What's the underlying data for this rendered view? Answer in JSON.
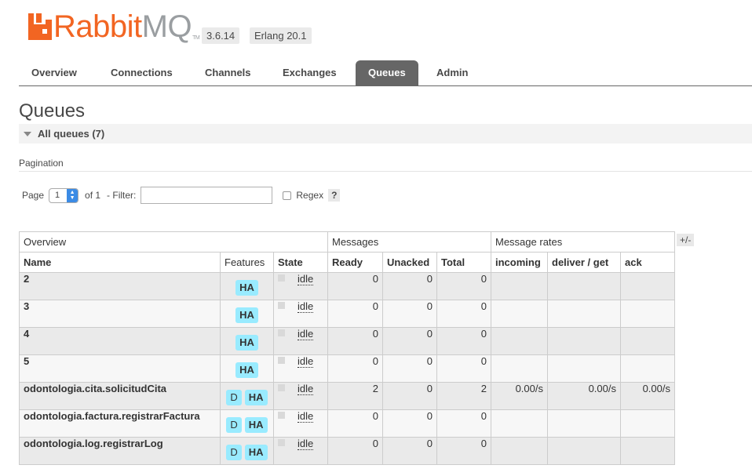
{
  "header": {
    "logo_rabbit": "Rabbit",
    "logo_mq": "MQ",
    "logo_tm": "TM",
    "version": "3.6.14",
    "erlang": "Erlang 20.1"
  },
  "tabs": [
    {
      "label": "Overview"
    },
    {
      "label": "Connections"
    },
    {
      "label": "Channels"
    },
    {
      "label": "Exchanges"
    },
    {
      "label": "Queues"
    },
    {
      "label": "Admin"
    }
  ],
  "page_title": "Queues",
  "all_queues_label": "All queues (7)",
  "pagination": {
    "label": "Pagination",
    "page_label": "Page",
    "page_value": "1",
    "of_label": "of 1",
    "filter_label": "- Filter:",
    "filter_value": "",
    "regex_label": "Regex",
    "help_label": "?"
  },
  "table": {
    "groups": {
      "overview": "Overview",
      "messages": "Messages",
      "rates": "Message rates"
    },
    "columns": {
      "name": "Name",
      "features": "Features",
      "state": "State",
      "ready": "Ready",
      "unacked": "Unacked",
      "total": "Total",
      "incoming": "incoming",
      "deliver": "deliver / get",
      "ack": "ack"
    },
    "plus_minus": "+/-",
    "rows": [
      {
        "name": "2",
        "d": "",
        "ha": "HA",
        "state": "idle",
        "ready": "0",
        "unacked": "0",
        "total": "0",
        "incoming": "",
        "deliver": "",
        "ack": ""
      },
      {
        "name": "3",
        "d": "",
        "ha": "HA",
        "state": "idle",
        "ready": "0",
        "unacked": "0",
        "total": "0",
        "incoming": "",
        "deliver": "",
        "ack": ""
      },
      {
        "name": "4",
        "d": "",
        "ha": "HA",
        "state": "idle",
        "ready": "0",
        "unacked": "0",
        "total": "0",
        "incoming": "",
        "deliver": "",
        "ack": ""
      },
      {
        "name": "5",
        "d": "",
        "ha": "HA",
        "state": "idle",
        "ready": "0",
        "unacked": "0",
        "total": "0",
        "incoming": "",
        "deliver": "",
        "ack": ""
      },
      {
        "name": "odontologia.cita.solicitudCita",
        "d": "D",
        "ha": "HA",
        "state": "idle",
        "ready": "2",
        "unacked": "0",
        "total": "2",
        "incoming": "0.00/s",
        "deliver": "0.00/s",
        "ack": "0.00/s"
      },
      {
        "name": "odontologia.factura.registrarFactura",
        "d": "D",
        "ha": "HA",
        "state": "idle",
        "ready": "0",
        "unacked": "0",
        "total": "0",
        "incoming": "",
        "deliver": "",
        "ack": ""
      },
      {
        "name": "odontologia.log.registrarLog",
        "d": "D",
        "ha": "HA",
        "state": "idle",
        "ready": "0",
        "unacked": "0",
        "total": "0",
        "incoming": "",
        "deliver": "",
        "ack": ""
      }
    ]
  },
  "colors": {
    "brand": "#f26522",
    "tab_active": "#666666",
    "badge": "#99ebff"
  }
}
